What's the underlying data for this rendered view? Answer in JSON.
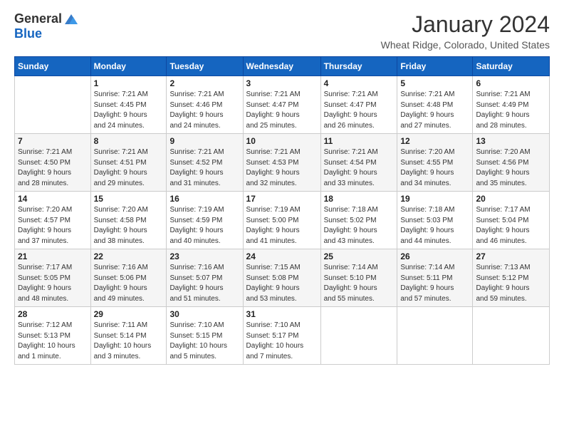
{
  "header": {
    "logo_general": "General",
    "logo_blue": "Blue",
    "title": "January 2024",
    "subtitle": "Wheat Ridge, Colorado, United States"
  },
  "weekdays": [
    "Sunday",
    "Monday",
    "Tuesday",
    "Wednesday",
    "Thursday",
    "Friday",
    "Saturday"
  ],
  "weeks": [
    [
      {
        "day": "",
        "info": ""
      },
      {
        "day": "1",
        "info": "Sunrise: 7:21 AM\nSunset: 4:45 PM\nDaylight: 9 hours\nand 24 minutes."
      },
      {
        "day": "2",
        "info": "Sunrise: 7:21 AM\nSunset: 4:46 PM\nDaylight: 9 hours\nand 24 minutes."
      },
      {
        "day": "3",
        "info": "Sunrise: 7:21 AM\nSunset: 4:47 PM\nDaylight: 9 hours\nand 25 minutes."
      },
      {
        "day": "4",
        "info": "Sunrise: 7:21 AM\nSunset: 4:47 PM\nDaylight: 9 hours\nand 26 minutes."
      },
      {
        "day": "5",
        "info": "Sunrise: 7:21 AM\nSunset: 4:48 PM\nDaylight: 9 hours\nand 27 minutes."
      },
      {
        "day": "6",
        "info": "Sunrise: 7:21 AM\nSunset: 4:49 PM\nDaylight: 9 hours\nand 28 minutes."
      }
    ],
    [
      {
        "day": "7",
        "info": "Sunrise: 7:21 AM\nSunset: 4:50 PM\nDaylight: 9 hours\nand 28 minutes."
      },
      {
        "day": "8",
        "info": "Sunrise: 7:21 AM\nSunset: 4:51 PM\nDaylight: 9 hours\nand 29 minutes."
      },
      {
        "day": "9",
        "info": "Sunrise: 7:21 AM\nSunset: 4:52 PM\nDaylight: 9 hours\nand 31 minutes."
      },
      {
        "day": "10",
        "info": "Sunrise: 7:21 AM\nSunset: 4:53 PM\nDaylight: 9 hours\nand 32 minutes."
      },
      {
        "day": "11",
        "info": "Sunrise: 7:21 AM\nSunset: 4:54 PM\nDaylight: 9 hours\nand 33 minutes."
      },
      {
        "day": "12",
        "info": "Sunrise: 7:20 AM\nSunset: 4:55 PM\nDaylight: 9 hours\nand 34 minutes."
      },
      {
        "day": "13",
        "info": "Sunrise: 7:20 AM\nSunset: 4:56 PM\nDaylight: 9 hours\nand 35 minutes."
      }
    ],
    [
      {
        "day": "14",
        "info": "Sunrise: 7:20 AM\nSunset: 4:57 PM\nDaylight: 9 hours\nand 37 minutes."
      },
      {
        "day": "15",
        "info": "Sunrise: 7:20 AM\nSunset: 4:58 PM\nDaylight: 9 hours\nand 38 minutes."
      },
      {
        "day": "16",
        "info": "Sunrise: 7:19 AM\nSunset: 4:59 PM\nDaylight: 9 hours\nand 40 minutes."
      },
      {
        "day": "17",
        "info": "Sunrise: 7:19 AM\nSunset: 5:00 PM\nDaylight: 9 hours\nand 41 minutes."
      },
      {
        "day": "18",
        "info": "Sunrise: 7:18 AM\nSunset: 5:02 PM\nDaylight: 9 hours\nand 43 minutes."
      },
      {
        "day": "19",
        "info": "Sunrise: 7:18 AM\nSunset: 5:03 PM\nDaylight: 9 hours\nand 44 minutes."
      },
      {
        "day": "20",
        "info": "Sunrise: 7:17 AM\nSunset: 5:04 PM\nDaylight: 9 hours\nand 46 minutes."
      }
    ],
    [
      {
        "day": "21",
        "info": "Sunrise: 7:17 AM\nSunset: 5:05 PM\nDaylight: 9 hours\nand 48 minutes."
      },
      {
        "day": "22",
        "info": "Sunrise: 7:16 AM\nSunset: 5:06 PM\nDaylight: 9 hours\nand 49 minutes."
      },
      {
        "day": "23",
        "info": "Sunrise: 7:16 AM\nSunset: 5:07 PM\nDaylight: 9 hours\nand 51 minutes."
      },
      {
        "day": "24",
        "info": "Sunrise: 7:15 AM\nSunset: 5:08 PM\nDaylight: 9 hours\nand 53 minutes."
      },
      {
        "day": "25",
        "info": "Sunrise: 7:14 AM\nSunset: 5:10 PM\nDaylight: 9 hours\nand 55 minutes."
      },
      {
        "day": "26",
        "info": "Sunrise: 7:14 AM\nSunset: 5:11 PM\nDaylight: 9 hours\nand 57 minutes."
      },
      {
        "day": "27",
        "info": "Sunrise: 7:13 AM\nSunset: 5:12 PM\nDaylight: 9 hours\nand 59 minutes."
      }
    ],
    [
      {
        "day": "28",
        "info": "Sunrise: 7:12 AM\nSunset: 5:13 PM\nDaylight: 10 hours\nand 1 minute."
      },
      {
        "day": "29",
        "info": "Sunrise: 7:11 AM\nSunset: 5:14 PM\nDaylight: 10 hours\nand 3 minutes."
      },
      {
        "day": "30",
        "info": "Sunrise: 7:10 AM\nSunset: 5:15 PM\nDaylight: 10 hours\nand 5 minutes."
      },
      {
        "day": "31",
        "info": "Sunrise: 7:10 AM\nSunset: 5:17 PM\nDaylight: 10 hours\nand 7 minutes."
      },
      {
        "day": "",
        "info": ""
      },
      {
        "day": "",
        "info": ""
      },
      {
        "day": "",
        "info": ""
      }
    ]
  ]
}
